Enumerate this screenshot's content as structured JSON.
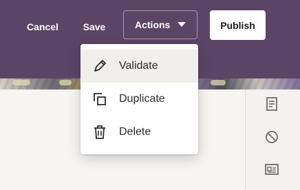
{
  "header": {
    "cancel_label": "Cancel",
    "save_label": "Save",
    "actions_label": "Actions",
    "publish_label": "Publish"
  },
  "actions_menu": {
    "items": [
      {
        "label": "Validate",
        "icon": "pencil-icon"
      },
      {
        "label": "Duplicate",
        "icon": "duplicate-icon"
      },
      {
        "label": "Delete",
        "icon": "trash-icon"
      }
    ]
  },
  "right_rail": {
    "icons": [
      "document-icon",
      "blocked-icon",
      "id-card-icon"
    ]
  },
  "colors": {
    "header_bg": "#5b4566",
    "content_bg": "#f7f5f2",
    "menu_hover": "#f1efec",
    "icon_color": "#2b2b2b",
    "rail_icon_color": "#6f6a66"
  }
}
